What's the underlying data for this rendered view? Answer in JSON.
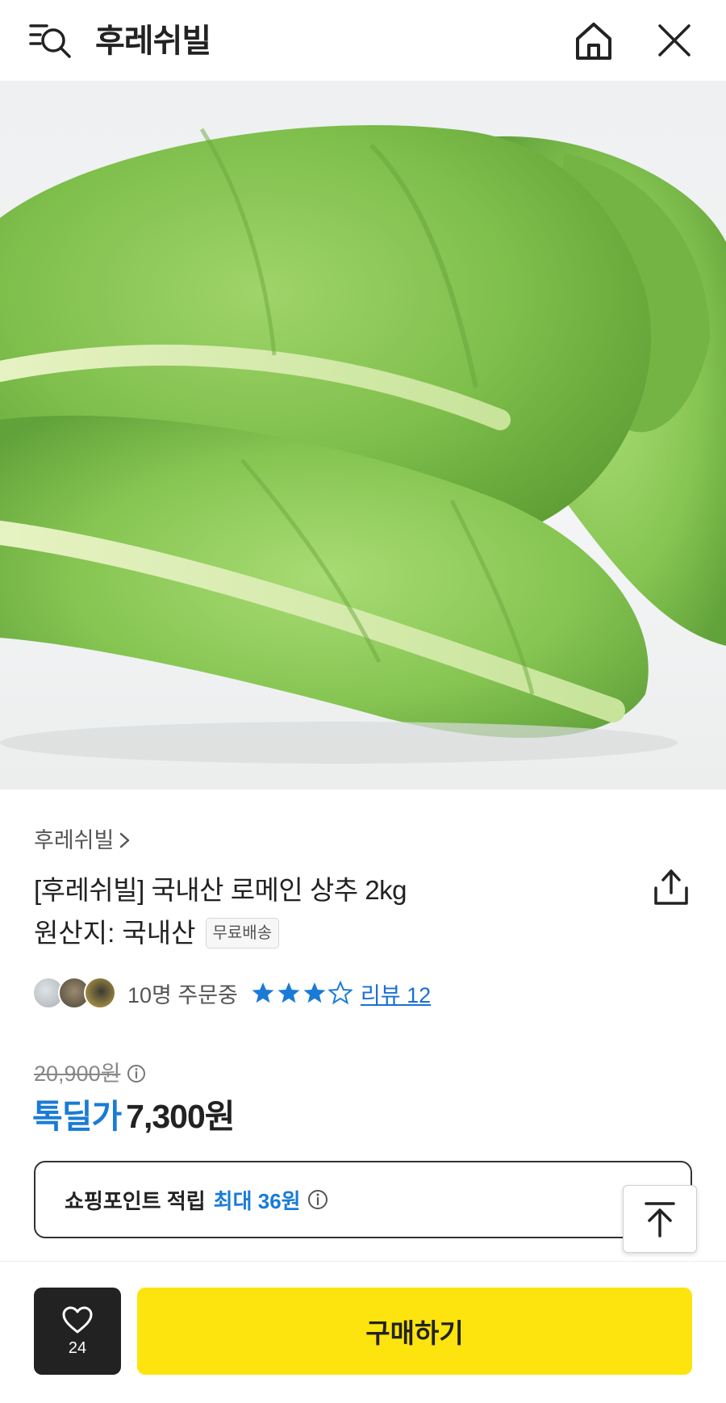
{
  "header": {
    "title": "후레쉬빌",
    "search_icon": "search-menu-icon",
    "home_icon": "home-icon",
    "close_icon": "close-icon"
  },
  "product": {
    "brand": "후레쉬빌",
    "title": "[후레쉬빌] 국내산 로메인 상추 2kg",
    "origin": "원산지: 국내산",
    "shipping_badge": "무료배송",
    "image_alt": "로메인 상추"
  },
  "social": {
    "order_count": "10명 주문중",
    "rating": 3,
    "rating_max": 4,
    "review_link": "리뷰 12"
  },
  "price": {
    "original": "20,900원",
    "deal_label": "톡딜가",
    "deal_price": "7,300원"
  },
  "points": {
    "label": "쇼핑포인트 적립",
    "value": "최대 36원"
  },
  "bottom": {
    "like_count": "24",
    "buy_label": "구매하기"
  },
  "colors": {
    "accent_blue": "#1a7bd6",
    "buy_yellow": "#fde40e",
    "dark": "#222222"
  }
}
